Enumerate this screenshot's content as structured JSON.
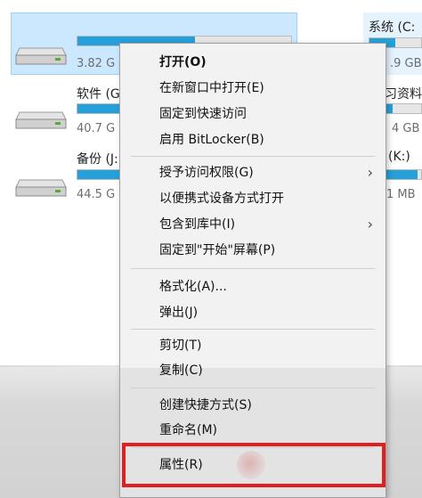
{
  "drives": {
    "left": [
      {
        "label": "",
        "size": "3.82 G",
        "fill": 0.55
      },
      {
        "label": "软件 (G",
        "size": "40.7 G",
        "fill": 0.35
      },
      {
        "label": "备份 (J:",
        "size": "44.5 G",
        "fill": 0.3
      }
    ],
    "right": [
      {
        "label": "系统 (C:",
        "size": ".9 GB",
        "fill": 0.5
      },
      {
        "label": "习资料",
        "size": "4 GB",
        "fill": 0.2
      },
      {
        "label": "(K:)",
        "size": "1 MB",
        "fill": 0.9
      }
    ]
  },
  "context_menu": {
    "items": [
      {
        "label": "打开(O)",
        "bold": true,
        "submenu": false
      },
      {
        "label": "在新窗口中打开(E)",
        "bold": false,
        "submenu": false
      },
      {
        "label": "固定到快速访问",
        "bold": false,
        "submenu": false
      },
      {
        "label": "启用 BitLocker(B)",
        "bold": false,
        "submenu": false
      },
      {
        "label": "授予访问权限(G)",
        "bold": false,
        "submenu": true
      },
      {
        "label": "以便携式设备方式打开",
        "bold": false,
        "submenu": false
      },
      {
        "label": "包含到库中(I)",
        "bold": false,
        "submenu": true
      },
      {
        "label": "固定到\"开始\"屏幕(P)",
        "bold": false,
        "submenu": false
      },
      {
        "label": "格式化(A)...",
        "bold": false,
        "submenu": false
      },
      {
        "label": "弹出(J)",
        "bold": false,
        "submenu": false
      },
      {
        "label": "剪切(T)",
        "bold": false,
        "submenu": false
      },
      {
        "label": "复制(C)",
        "bold": false,
        "submenu": false
      },
      {
        "label": "创建快捷方式(S)",
        "bold": false,
        "submenu": false
      },
      {
        "label": "重命名(M)",
        "bold": false,
        "submenu": false
      },
      {
        "label": "属性(R)",
        "bold": false,
        "submenu": false
      }
    ],
    "submenu_arrow": "›"
  },
  "highlight_color": "#e02020",
  "accent_color": "#26a0da"
}
